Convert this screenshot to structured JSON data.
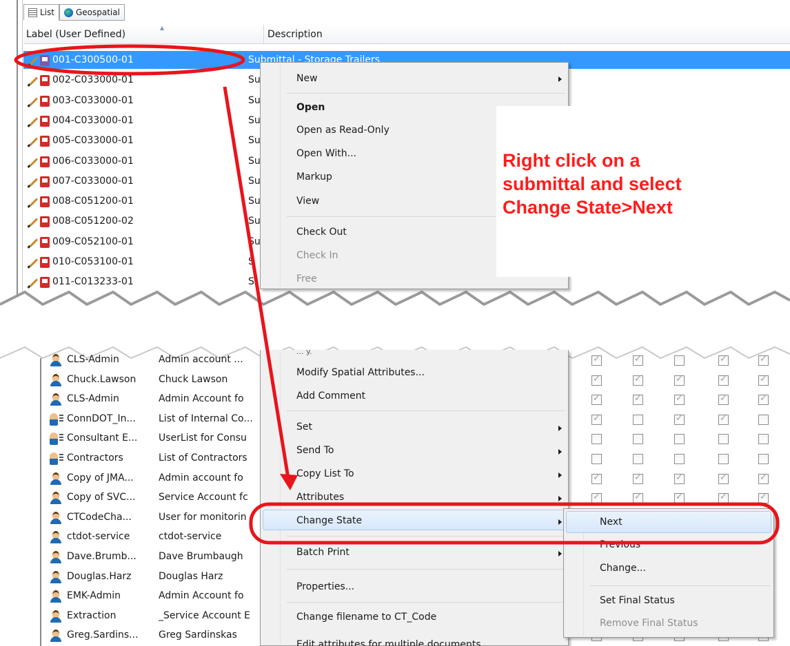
{
  "tabs": [
    {
      "label": "List",
      "icon": "list-icon"
    },
    {
      "label": "Geospatial",
      "icon": "globe-icon"
    }
  ],
  "columns": {
    "label": "Label (User Defined)",
    "description": "Description"
  },
  "documents": [
    {
      "label": "001-C300500-01",
      "description": "Submittal - Storage Trailers",
      "selected": true
    },
    {
      "label": "002-C033000-01",
      "description": "Su"
    },
    {
      "label": "003-C033000-01",
      "description": "Su"
    },
    {
      "label": "004-C033000-01",
      "description": "Su"
    },
    {
      "label": "005-C033000-01",
      "description": "Su"
    },
    {
      "label": "006-C033000-01",
      "description": "Su"
    },
    {
      "label": "007-C033000-01",
      "description": "Su"
    },
    {
      "label": "008-C051200-01",
      "description": "Su"
    },
    {
      "label": "008-C051200-02",
      "description": "Su"
    },
    {
      "label": "009-C052100-01",
      "description": "Su"
    },
    {
      "label": "010-C053100-01",
      "description": "S"
    },
    {
      "label": "011-C013233-01",
      "description": "S"
    }
  ],
  "users": [
    {
      "name": "CLS-Admin",
      "desc": "Admin account ...",
      "type": "user",
      "checks": [
        1,
        1,
        0,
        1,
        1
      ],
      "partial": true
    },
    {
      "name": "Chuck.Lawson",
      "desc": "Chuck Lawson",
      "type": "user",
      "checks": [
        1,
        1,
        1,
        1,
        1
      ]
    },
    {
      "name": "CLS-Admin",
      "desc": "Admin Account fo",
      "type": "user",
      "checks": [
        1,
        1,
        1,
        1,
        1
      ]
    },
    {
      "name": "ConnDOT_In...",
      "desc": "List of Internal Co...",
      "type": "group",
      "checks": [
        1,
        0,
        1,
        1,
        0
      ]
    },
    {
      "name": "Consultant E...",
      "desc": "UserList for Consu",
      "type": "group",
      "checks": [
        0,
        0,
        0,
        0,
        0
      ]
    },
    {
      "name": "Contractors",
      "desc": "List of Contractors",
      "type": "group",
      "checks": [
        0,
        0,
        0,
        0,
        0
      ]
    },
    {
      "name": "Copy of JMA...",
      "desc": "Admin account fo",
      "type": "user",
      "checks": [
        1,
        1,
        1,
        1,
        1
      ]
    },
    {
      "name": "Copy of SVC...",
      "desc": "Service Account fc",
      "type": "user",
      "checks": [
        1,
        1,
        1,
        1,
        1
      ]
    },
    {
      "name": "CTCodeCha...",
      "desc": "User for monitorin",
      "type": "user",
      "checks": [
        0,
        0,
        0,
        0,
        0
      ]
    },
    {
      "name": "ctdot-service",
      "desc": "ctdot-service",
      "type": "user",
      "checks": [
        0,
        0,
        0,
        0,
        0
      ]
    },
    {
      "name": "Dave.Brumb...",
      "desc": "Dave Brumbaugh",
      "type": "user",
      "checks": [
        0,
        0,
        0,
        0,
        0
      ]
    },
    {
      "name": "Douglas.Harz",
      "desc": "Douglas Harz",
      "type": "user",
      "checks": [
        0,
        0,
        0,
        0,
        0
      ]
    },
    {
      "name": "EMK-Admin",
      "desc": "Admin Account fo",
      "type": "user",
      "checks": [
        0,
        0,
        0,
        0,
        0
      ]
    },
    {
      "name": "Extraction",
      "desc": "_Service Account E",
      "type": "user",
      "checks": [
        0,
        0,
        0,
        0,
        0
      ]
    },
    {
      "name": "Greg.Sardins...",
      "desc": "Greg Sardinskas",
      "type": "user",
      "checks": [
        0,
        0,
        0,
        0,
        0
      ]
    }
  ],
  "context_menu_top": {
    "items": [
      {
        "label": "New",
        "submenu": true
      },
      {
        "label": "Open",
        "bold": true
      },
      {
        "label": "Open as Read-Only"
      },
      {
        "label": "Open With..."
      },
      {
        "label": "Markup"
      },
      {
        "label": "View"
      },
      {
        "label": "Check Out"
      },
      {
        "label": "Check In",
        "disabled": true
      },
      {
        "label": "Free",
        "disabled": true
      }
    ]
  },
  "context_menu_bottom": {
    "items": [
      {
        "label": "Modify Spatial Attributes..."
      },
      {
        "label": "Add Comment"
      },
      {
        "label": "Set",
        "submenu": true
      },
      {
        "label": "Send To",
        "submenu": true
      },
      {
        "label": "Copy List To",
        "submenu": true
      },
      {
        "label": "Attributes",
        "submenu": true
      },
      {
        "label": "Change State",
        "submenu": true,
        "highlighted": true
      },
      {
        "label": "Batch Print",
        "submenu": true
      },
      {
        "label": "Properties..."
      },
      {
        "label": "Change filename to CT_Code"
      },
      {
        "label": "Edit attributes for multiple documents"
      }
    ]
  },
  "submenu_change_state": {
    "items": [
      {
        "label": "Next",
        "highlighted": true
      },
      {
        "label": "Previous"
      },
      {
        "label": "Change..."
      },
      {
        "label": "Set Final Status"
      },
      {
        "label": "Remove Final Status",
        "disabled": true
      }
    ]
  },
  "callout": {
    "lines": [
      "Right click on a",
      "submittal and select",
      "Change State>Next"
    ],
    "color": "#ff1c1c"
  },
  "colors": {
    "selection": "#3399ff",
    "annotation": "#e8151b",
    "menu_highlight": "#d7e8fb"
  }
}
